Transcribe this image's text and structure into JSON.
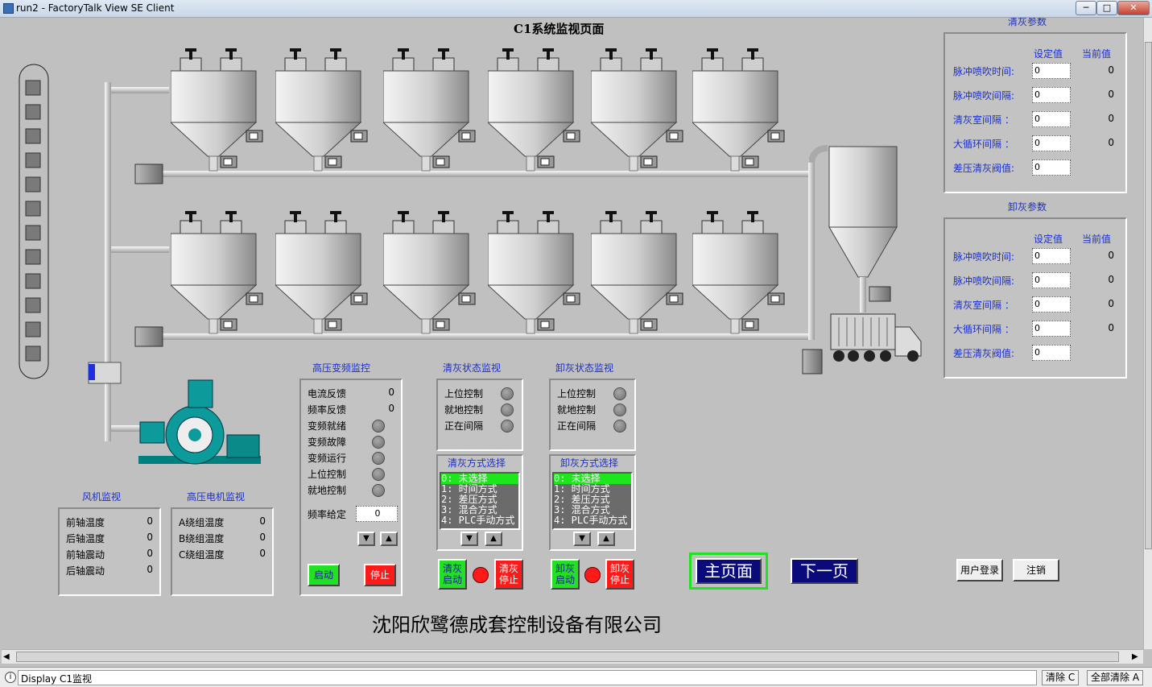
{
  "window": {
    "title": "run2 - FactoryTalk View SE Client",
    "min": "─",
    "max": "□",
    "close": "✕"
  },
  "page_title": "C1系统监视页面",
  "right_panels": {
    "qinghui": {
      "title": "清灰参数",
      "col_set": "设定值",
      "col_cur": "当前值",
      "rows": [
        {
          "label": "脉冲喷吹时间:",
          "input": "0",
          "cur": "0"
        },
        {
          "label": "脉冲喷吹间隔:",
          "input": "0",
          "cur": "0"
        },
        {
          "label": "清灰室间隔 ：",
          "input": "0",
          "cur": "0"
        },
        {
          "label": "大循环间隔 ：",
          "input": "0",
          "cur": "0"
        },
        {
          "label": "差压清灰阀值:",
          "input": "0",
          "cur": ""
        }
      ]
    },
    "xiehui": {
      "title": "卸灰参数",
      "col_set": "设定值",
      "col_cur": "当前值",
      "rows": [
        {
          "label": "脉冲喷吹时间:",
          "input": "0",
          "cur": "0"
        },
        {
          "label": "脉冲喷吹间隔:",
          "input": "0",
          "cur": "0"
        },
        {
          "label": "清灰室间隔 ：",
          "input": "0",
          "cur": "0"
        },
        {
          "label": "大循环间隔 ：",
          "input": "0",
          "cur": "0"
        },
        {
          "label": "差压清灰阀值:",
          "input": "0",
          "cur": ""
        }
      ]
    }
  },
  "fan": {
    "title": "风机监视",
    "rows": [
      {
        "label": "前轴温度",
        "val": "0"
      },
      {
        "label": "后轴温度",
        "val": "0"
      },
      {
        "label": "前轴震动",
        "val": "0"
      },
      {
        "label": "后轴震动",
        "val": "0"
      }
    ]
  },
  "motor": {
    "title": "高压电机监视",
    "rows": [
      {
        "label": "A绕组温度",
        "val": "0"
      },
      {
        "label": "B绕组温度",
        "val": "0"
      },
      {
        "label": "C绕组温度",
        "val": "0"
      }
    ]
  },
  "vfd": {
    "title": "高压变频监控",
    "current_label": "电流反馈",
    "current_val": "0",
    "freq_label": "频率反馈",
    "freq_val": "0",
    "leds": [
      "变频就绪",
      "变频故障",
      "变频运行",
      "上位控制",
      "就地控制"
    ],
    "set_label": "频率给定",
    "set_val": "0",
    "start": "启动",
    "stop": "停止"
  },
  "clean_status": {
    "title": "清灰状态监视",
    "leds": [
      "上位控制",
      "就地控制",
      "正在间隔"
    ]
  },
  "unload_status": {
    "title": "卸灰状态监视",
    "leds": [
      "上位控制",
      "就地控制",
      "正在间隔"
    ]
  },
  "clean_mode": {
    "title": "清灰方式选择",
    "options": [
      "0: 未选择",
      "1: 时间方式",
      "2: 差压方式",
      "3: 混合方式",
      "4: PLC手动方式"
    ],
    "start": "清灰\n启动",
    "stop": "清灰\n停止"
  },
  "unload_mode": {
    "title": "卸灰方式选择",
    "options": [
      "0: 未选择",
      "1: 时间方式",
      "2: 差压方式",
      "3: 混合方式",
      "4: PLC手动方式"
    ],
    "start": "卸灰\n启动",
    "stop": "卸灰\n停止"
  },
  "nav": {
    "home": "主页面",
    "next": "下一页",
    "login": "用户登录",
    "logout": "注销"
  },
  "company": "沈阳欣鹭德成套控制设备有限公司",
  "statusbar": {
    "message": "Display C1监视",
    "clear": "清除 C",
    "clear_all": "全部清除 A"
  },
  "icons": {
    "arrow_down": "down-arrow-icon",
    "arrow_up": "up-arrow-icon",
    "info": "info-icon"
  }
}
